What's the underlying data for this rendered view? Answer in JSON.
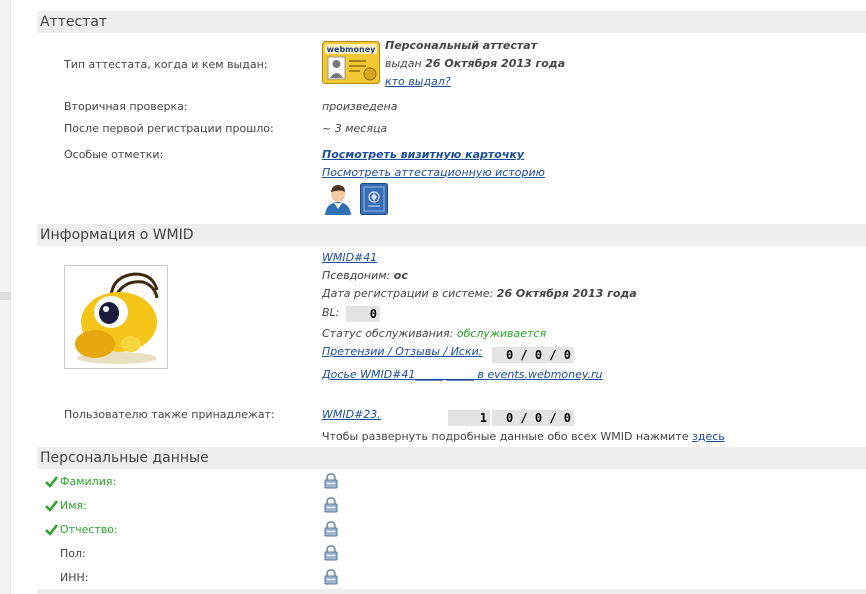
{
  "attestat": {
    "title": "Аттестат",
    "type_label": "Тип аттестата, когда и кем выдан:",
    "cert_logo_text": "webmoney",
    "cert_name": "Персональный аттестат",
    "issued_prefix": "выдан",
    "issued_date": "26 Октября 2013 года",
    "issuer_link": "кто выдал?",
    "secondary_label": "Вторичная проверка:",
    "secondary_value": "произведена",
    "since_label": "После первой регистрации прошло:",
    "since_value": "~ 3 месяца",
    "marks_label": "Особые отметки:",
    "card_link": "Посмотреть визитную карточку",
    "history_link": "Посмотреть аттестационную историю",
    "icons": [
      "user-icon",
      "passport-icon"
    ]
  },
  "wmid": {
    "title": "Информация о WMID",
    "wmid_link": "WMID#41",
    "nick_label": "Псевдоним:",
    "nick_value": "ос",
    "reg_label": "Дата регистрации в системе:",
    "reg_value": "26 Октября 2013 года",
    "bl_label": "BL:",
    "bl_value": "0",
    "status_label": "Статус обслуживания:",
    "status_value": "обслуживается",
    "claims_link": "Претензии / Отзывы / Иски:",
    "claims_value": "0 / 0 / 0",
    "dossier_link": "Досье WMID#41_____ _____ в events.webmoney.ru",
    "also_label": "Пользователю также принадлежат:",
    "also_wmid": "WMID#23.",
    "also_bl": "1",
    "also_claims": "0 / 0 / 0",
    "expand_text": "Чтобы развернуть подробные данные обо всех WMID нажмите",
    "expand_link": "здесь"
  },
  "personal": {
    "title": "Персональные данные",
    "fields": [
      {
        "label": "Фамилия:",
        "verified": true
      },
      {
        "label": "Имя:",
        "verified": true
      },
      {
        "label": "Отчество:",
        "verified": true
      },
      {
        "label": "Пол:",
        "verified": false
      },
      {
        "label": "ИНН:",
        "verified": false
      }
    ]
  },
  "colors": {
    "header_bg": "#eeeeee",
    "link": "#1a4d9c",
    "ok_green": "#2aa52a",
    "counter_bg": "#e4e4e4"
  }
}
